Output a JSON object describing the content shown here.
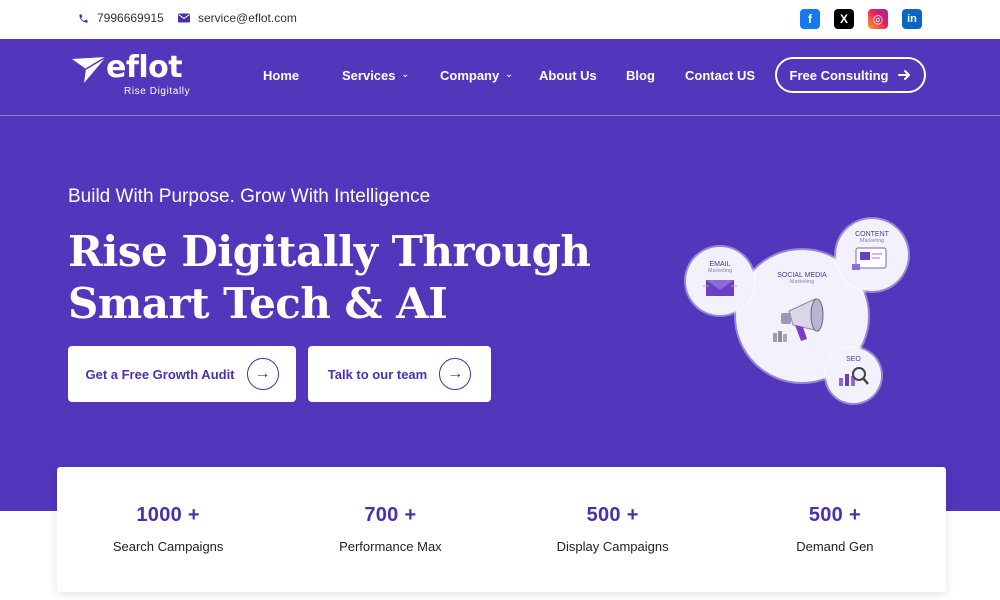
{
  "topbar": {
    "phone": "7996669915",
    "email": "service@eflot.com",
    "socials": [
      {
        "name": "facebook-icon",
        "glyph": "f"
      },
      {
        "name": "x-icon",
        "glyph": "X"
      },
      {
        "name": "instagram-icon",
        "glyph": "◎"
      },
      {
        "name": "linkedin-icon",
        "glyph": "in"
      }
    ]
  },
  "header": {
    "logo_text": "eflot",
    "logo_tagline": "Rise Digitally",
    "nav": {
      "home": "Home",
      "services": "Services",
      "company": "Company",
      "about": "About Us",
      "blog": "Blog",
      "contact": "Contact US"
    },
    "cta_label": "Free Consulting"
  },
  "hero": {
    "tagline": "Build With Purpose. Grow With Intelligence",
    "headline_line1": "Rise Digitally Through",
    "headline_line2": "Smart Tech & AI",
    "button_audit": "Get a Free Growth Audit",
    "button_team": "Talk to our team",
    "illustration": {
      "social_title": "SOCIAL MEDIA",
      "social_sub": "Marketing",
      "email_title": "EMAIL",
      "email_sub": "Marketing",
      "content_title": "CONTENT",
      "content_sub": "Marketing",
      "seo_title": "SEO"
    }
  },
  "stats": [
    {
      "value": "1000 +",
      "label": "Search Campaigns"
    },
    {
      "value": "700 +",
      "label": "Performance Max"
    },
    {
      "value": "500 +",
      "label": "Display Campaigns"
    },
    {
      "value": "500 +",
      "label": "Demand Gen"
    }
  ],
  "colors": {
    "brand": "#5237bd",
    "accent_text": "#4b2fb0"
  }
}
